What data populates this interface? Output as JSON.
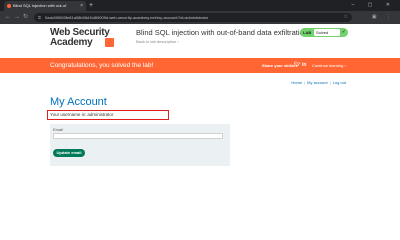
{
  "browser": {
    "tab_title": "Blind SQL injection with out-of",
    "tab_close": "×",
    "new_tab": "+",
    "window_controls": "–  ▢  ✕",
    "url": "0adc00f603fe81a08b06d1b8f4009d.web-security-academy.net/my-account?id=administrator"
  },
  "header": {
    "logo_line1": "Web Security",
    "logo_line2": "Academy",
    "lab_title": "Blind SQL injection with out-of-band data exfiltration",
    "back_link": "Back to lab description",
    "badge_label": "LAB",
    "badge_status": "Solved"
  },
  "banner": {
    "message": "Congratulations, you solved the lab!",
    "share_label": "Share your skills!",
    "continue_label": "Continue learning",
    "colors": {
      "background": "#ff6633",
      "text": "#ffffff"
    }
  },
  "nav": {
    "home": "Home",
    "my_account": "My account",
    "log_out": "Log out"
  },
  "account": {
    "title": "My Account",
    "username_text": "Your username is: administrator",
    "email_label": "Email",
    "email_value": "",
    "update_button": "Update email"
  },
  "icons": [
    "back-arrow-icon",
    "forward-arrow-icon",
    "reload-icon",
    "lock-icon",
    "star-icon",
    "twitter-icon",
    "linkedin-icon",
    "chevron-right-icon",
    "check-icon"
  ]
}
